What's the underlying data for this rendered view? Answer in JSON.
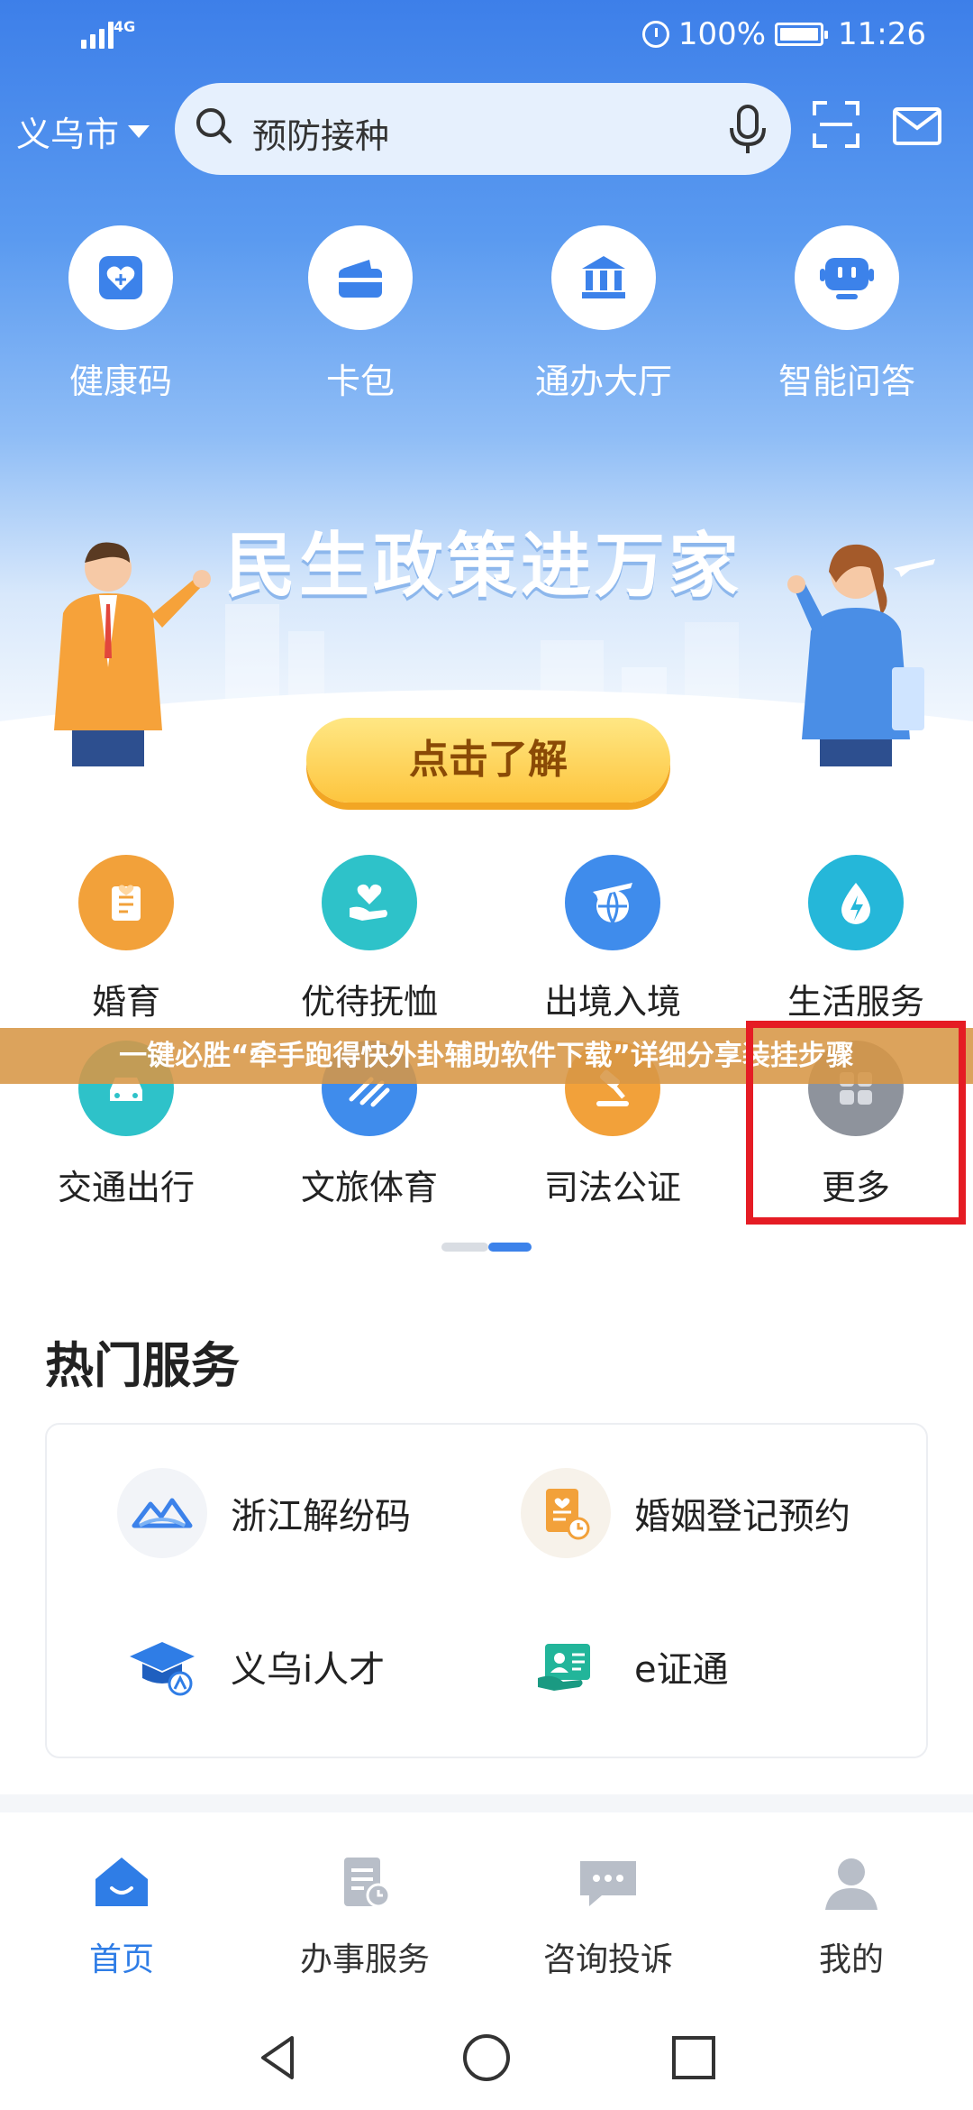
{
  "status_bar": {
    "network": "4G",
    "battery": "100%",
    "time": "11:26"
  },
  "topbar": {
    "city": "义乌市",
    "search_placeholder": "预防接种"
  },
  "quick_actions": [
    {
      "label": "健康码",
      "icon": "health-code-icon"
    },
    {
      "label": "卡包",
      "icon": "wallet-icon"
    },
    {
      "label": "通办大厅",
      "icon": "hall-icon"
    },
    {
      "label": "智能问答",
      "icon": "robot-icon"
    }
  ],
  "banner": {
    "title": "民生政策进万家",
    "cta": "点击了解"
  },
  "services": [
    {
      "label": "婚育",
      "icon": "marriage-icon",
      "color": "#f2a13a"
    },
    {
      "label": "优待抚恤",
      "icon": "care-icon",
      "color": "#2ec2c9"
    },
    {
      "label": "出境入境",
      "icon": "airplane-globe-icon",
      "color": "#3f8cec"
    },
    {
      "label": "生活服务",
      "icon": "water-drop-icon",
      "color": "#25b7d9"
    },
    {
      "label": "交通出行",
      "icon": "car-icon",
      "color": "#2ec2c9"
    },
    {
      "label": "文旅体育",
      "icon": "sport-icon",
      "color": "#3f8cec"
    },
    {
      "label": "司法公证",
      "icon": "gavel-icon",
      "color": "#f2a13a"
    },
    {
      "label": "更多",
      "icon": "grid-icon",
      "color": "#8e939c"
    }
  ],
  "watermark": "一键必胜“牵手跑得快外卦辅助软件下载”详细分享装挂步骤",
  "hot": {
    "title": "热门服务",
    "items": [
      {
        "label": "浙江解纷码",
        "icon": "mountain-logo-icon"
      },
      {
        "label": "婚姻登记预约",
        "icon": "document-clock-icon"
      },
      {
        "label": "义乌i人才",
        "icon": "graduation-cap-icon"
      },
      {
        "label": "e证通",
        "icon": "id-card-icon"
      }
    ]
  },
  "tabs": [
    {
      "label": "首页",
      "icon": "home-icon",
      "active": true
    },
    {
      "label": "办事服务",
      "icon": "service-doc-icon"
    },
    {
      "label": "咨询投诉",
      "icon": "chat-icon"
    },
    {
      "label": "我的",
      "icon": "profile-icon"
    }
  ],
  "colors": {
    "primary": "#3c82ea",
    "cta": "#fdc53e",
    "highlight": "#e51c24"
  }
}
